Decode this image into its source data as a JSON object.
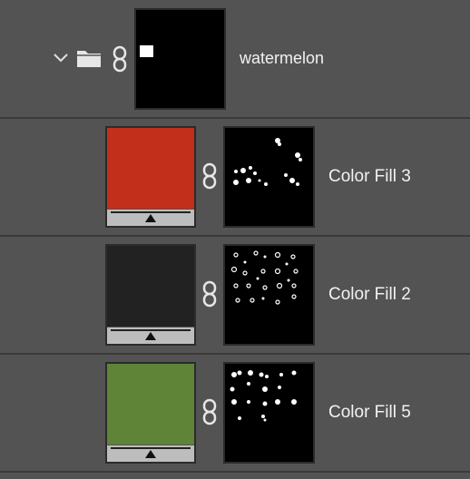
{
  "group": {
    "name": "watermelon",
    "icons": [
      "chevron-down-icon",
      "folder-icon",
      "link-icon"
    ]
  },
  "layers": [
    {
      "name": "Color Fill 3",
      "color": "#c22f1b"
    },
    {
      "name": "Color Fill 2",
      "color": "#222222"
    },
    {
      "name": "Color Fill 5",
      "color": "#5f8437"
    }
  ],
  "colors": {
    "panel_bg": "#535353",
    "separator": "#3a3a3a",
    "text": "#f2f2f2"
  }
}
